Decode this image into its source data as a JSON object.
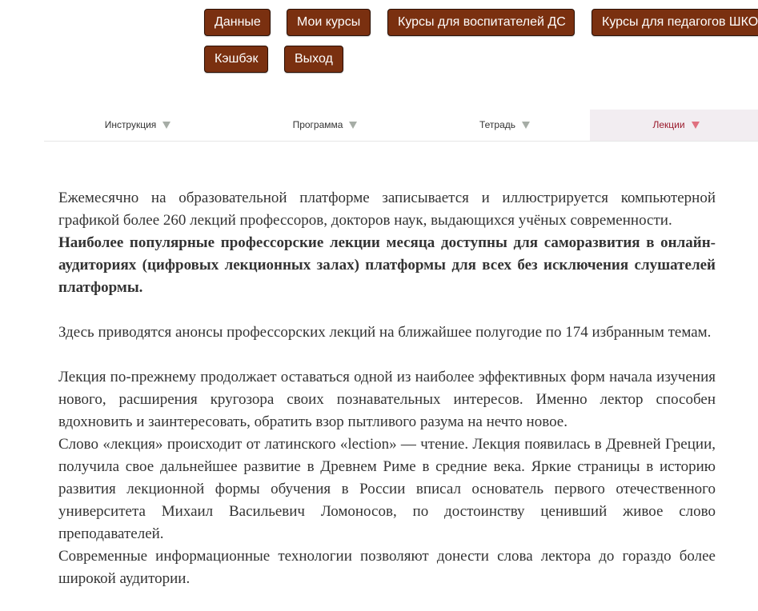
{
  "nav": {
    "data": "Данные",
    "my_courses": "Мои курсы",
    "courses_ds": "Курсы для воспитателей ДС",
    "courses_shko": "Курсы для педагогов ШКОЛ",
    "cashback": "Кэшбэк",
    "exit": "Выход"
  },
  "tabs": [
    {
      "label": "Инструкция"
    },
    {
      "label": "Программа"
    },
    {
      "label": "Тетрадь"
    },
    {
      "label": "Лекции",
      "active": true
    }
  ],
  "content": {
    "p1": "Ежемесячно на образовательной платформе записывается и иллюстрируется компьютерной графикой более 260 лекций профессоров, докторов наук, выдающихся учёных современности.",
    "p1_bold": "Наиболее популярные профессорские лекции месяца доступны для саморазвития в онлайн-аудиториях (цифровых лекционных залах) платформы для всех без исключения слушателей платформы.",
    "p2": "Здесь приводятся анонсы профессорских лекций на ближайшее полугодие по 174 избранным темам.",
    "p3": "Лекция по-прежнему продолжает оставаться одной из наиболее эффективных форм начала изучения нового, расширения кругозора своих познавательных интересов. Именно лектор способен вдохновить и заинтересовать, обратить взор пытливого разума на нечто новое.",
    "p4": "Слово «лекция» происходит от латинского «lection» — чтение. Лекция появилась в Древней Греции, получила свое дальнейшее развитие в Древнем Риме в средние века. Яркие страницы в историю развития лекционной формы обучения в России вписал основатель первого отечественного университета Михаил Васильевич Ломоносов, по достоинству ценивший живое слово преподавателей.",
    "p5": "Современные информационные технологии позволяют донести слова лектора до гораздо более широкой аудитории."
  },
  "colors": {
    "button_bg": "#7a3010",
    "active_tab_bg": "#f2edf1",
    "active_tab_text": "#9a1a2c",
    "arrow": "#a6ada6",
    "active_arrow": "#e0707f"
  }
}
